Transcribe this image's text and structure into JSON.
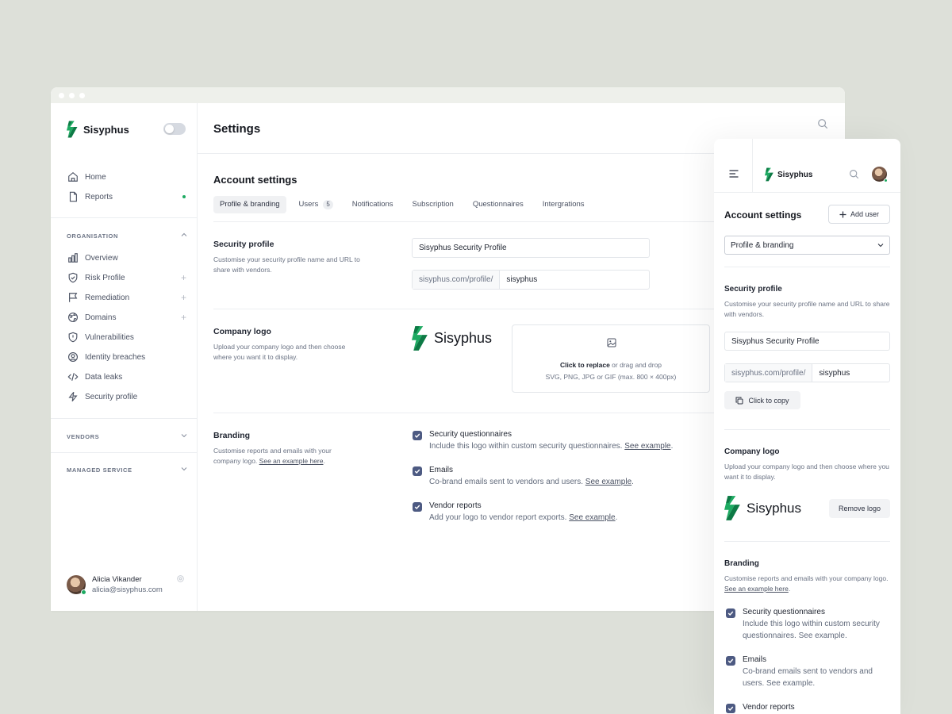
{
  "desktop": {
    "brand": "Sisyphus",
    "page_title": "Settings",
    "sidebar": {
      "nav": [
        {
          "label": "Home",
          "icon": "home-icon"
        },
        {
          "label": "Reports",
          "icon": "file-icon"
        }
      ],
      "organisation_label": "ORGANISATION",
      "org_items": [
        {
          "label": "Overview",
          "icon": "bar-chart-icon"
        },
        {
          "label": "Risk Profile",
          "icon": "shield-icon"
        },
        {
          "label": "Remediation",
          "icon": "flag-icon"
        },
        {
          "label": "Domains",
          "icon": "globe-icon"
        },
        {
          "label": "Vulnerabilities",
          "icon": "shield-alert-icon"
        },
        {
          "label": "Identity breaches",
          "icon": "user-circle-icon"
        },
        {
          "label": "Data leaks",
          "icon": "code-icon"
        },
        {
          "label": "Security profile",
          "icon": "zap-icon"
        }
      ],
      "vendors_label": "VENDORS",
      "managed_label": "MANAGED SERVICE",
      "user": {
        "name": "Alicia Vikander",
        "email": "alicia@sisyphus.com"
      }
    },
    "account_settings": "Account settings",
    "tabs": [
      {
        "label": "Profile & branding",
        "active": true
      },
      {
        "label": "Users",
        "badge": "5"
      },
      {
        "label": "Notifications"
      },
      {
        "label": "Subscription"
      },
      {
        "label": "Questionnaires"
      },
      {
        "label": "Intergrations"
      }
    ],
    "security_profile": {
      "title": "Security profile",
      "desc": "Customise your security profile name and URL to share with vendors.",
      "name_value": "Sisyphus Security Profile",
      "url_prefix": "sisyphus.com/profile/",
      "url_value": "sisyphus"
    },
    "company_logo": {
      "title": "Company logo",
      "desc": "Upload your company logo and then choose where you want it to display.",
      "logo_text": "Sisyphus",
      "upload_action": "Click to replace",
      "upload_rest": " or drag and drop",
      "upload_formats": "SVG, PNG, JPG or GIF (max. 800 × 400px)"
    },
    "branding": {
      "title": "Branding",
      "desc": "Customise reports and emails with your company logo.",
      "desc_link": "See an example here",
      "options": [
        {
          "title": "Security questionnaires",
          "desc": "Include this logo within custom security questionnaires.",
          "link": "See example",
          "checked": true
        },
        {
          "title": "Emails",
          "desc": "Co-brand emails sent to vendors and users.",
          "link": "See example",
          "checked": true
        },
        {
          "title": "Vendor reports",
          "desc": "Add your logo to vendor report exports.",
          "link": "See example",
          "checked": true
        }
      ]
    }
  },
  "mobile": {
    "brand": "Sisyphus",
    "title": "Account settings",
    "add_user": "Add user",
    "select_value": "Profile & branding",
    "security_profile": {
      "title": "Security profile",
      "desc": "Customise your security profile name and URL to share with vendors.",
      "name_value": "Sisyphus Security Profile",
      "url_prefix": "sisyphus.com/profile/",
      "url_value": "sisyphus",
      "copy_label": "Click to copy"
    },
    "company_logo": {
      "title": "Company logo",
      "desc": "Upload your company logo and then choose where you want it to display.",
      "logo_text": "Sisyphus",
      "remove_label": "Remove logo"
    },
    "branding": {
      "title": "Branding",
      "desc": "Customise reports and emails with your company logo.",
      "desc_link": "See an example here",
      "options": [
        {
          "title": "Security questionnaires",
          "desc": "Include this logo within custom security questionnaires.",
          "link": "See example",
          "checked": true
        },
        {
          "title": "Emails",
          "desc": "Co-brand emails sent to vendors and users.",
          "link": "See example",
          "checked": true
        },
        {
          "title": "Vendor reports",
          "checked": true
        }
      ]
    }
  },
  "colors": {
    "brand_green": "#1eaa62",
    "brand_dark_green": "#0d7a45",
    "checkbox": "#4d5a82",
    "background": "#dde0d9"
  }
}
